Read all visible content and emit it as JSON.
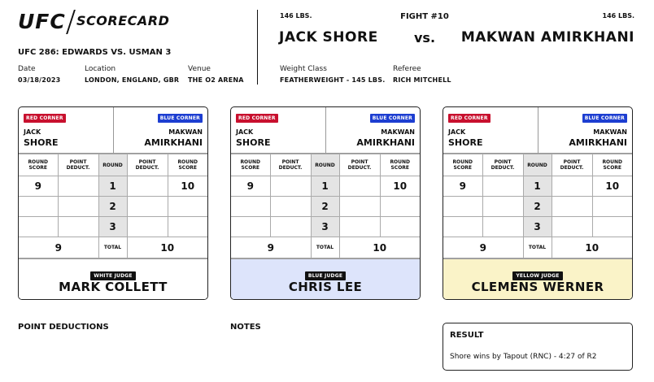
{
  "header": {
    "logo": "UFC",
    "logo_sub": "SCORECARD",
    "event": "UFC 286: EDWARDS VS. USMAN 3",
    "date_label": "Date",
    "date": "03/18/2023",
    "location_label": "Location",
    "location": "LONDON, ENGLAND, GBR",
    "venue_label": "Venue",
    "venue": "THE O2 ARENA"
  },
  "fight": {
    "number": "FIGHT #10",
    "weight_left": "146 LBS.",
    "weight_right": "146 LBS.",
    "fighter_left": "JACK SHORE",
    "vs": "vs.",
    "fighter_right": "MAKWAN AMIRKHANI",
    "weight_class_label": "Weight Class",
    "weight_class": "FEATHERWEIGHT - 145 LBS.",
    "referee_label": "Referee",
    "referee": "RICH MITCHELL"
  },
  "labels": {
    "red_corner": "RED CORNER",
    "blue_corner": "BLUE CORNER",
    "round_score": "ROUND SCORE",
    "point_deduct": "POINT DEDUCT.",
    "round": "ROUND",
    "total": "TOTAL",
    "red_first": "JACK",
    "red_last": "SHORE",
    "blue_first": "MAKWAN",
    "blue_last": "AMIRKHANI"
  },
  "cards": [
    {
      "judge_tag": "WHITE JUDGE",
      "judge_name": "MARK COLLETT",
      "rounds": [
        {
          "red_score": "9",
          "red_deduct": "",
          "round": "1",
          "blue_deduct": "",
          "blue_score": "10"
        },
        {
          "red_score": "",
          "red_deduct": "",
          "round": "2",
          "blue_deduct": "",
          "blue_score": ""
        },
        {
          "red_score": "",
          "red_deduct": "",
          "round": "3",
          "blue_deduct": "",
          "blue_score": ""
        }
      ],
      "red_total": "9",
      "blue_total": "10"
    },
    {
      "judge_tag": "BLUE JUDGE",
      "judge_name": "CHRIS LEE",
      "rounds": [
        {
          "red_score": "9",
          "red_deduct": "",
          "round": "1",
          "blue_deduct": "",
          "blue_score": "10"
        },
        {
          "red_score": "",
          "red_deduct": "",
          "round": "2",
          "blue_deduct": "",
          "blue_score": ""
        },
        {
          "red_score": "",
          "red_deduct": "",
          "round": "3",
          "blue_deduct": "",
          "blue_score": ""
        }
      ],
      "red_total": "9",
      "blue_total": "10"
    },
    {
      "judge_tag": "YELLOW JUDGE",
      "judge_name": "CLEMENS WERNER",
      "rounds": [
        {
          "red_score": "9",
          "red_deduct": "",
          "round": "1",
          "blue_deduct": "",
          "blue_score": "10"
        },
        {
          "red_score": "",
          "red_deduct": "",
          "round": "2",
          "blue_deduct": "",
          "blue_score": ""
        },
        {
          "red_score": "",
          "red_deduct": "",
          "round": "3",
          "blue_deduct": "",
          "blue_score": ""
        }
      ],
      "red_total": "9",
      "blue_total": "10"
    }
  ],
  "colors": {
    "red_corner": "#c8102e",
    "blue_corner": "#1d3ed1",
    "white_judge_bg": "#ffffff",
    "blue_judge_bg": "#dde4fb",
    "yellow_judge_bg": "#faf3c8"
  },
  "footer": {
    "point_deductions": "POINT DEDUCTIONS",
    "notes": "NOTES",
    "result_title": "RESULT",
    "result_text": "Shore wins by Tapout (RNC) - 4:27 of R2"
  }
}
